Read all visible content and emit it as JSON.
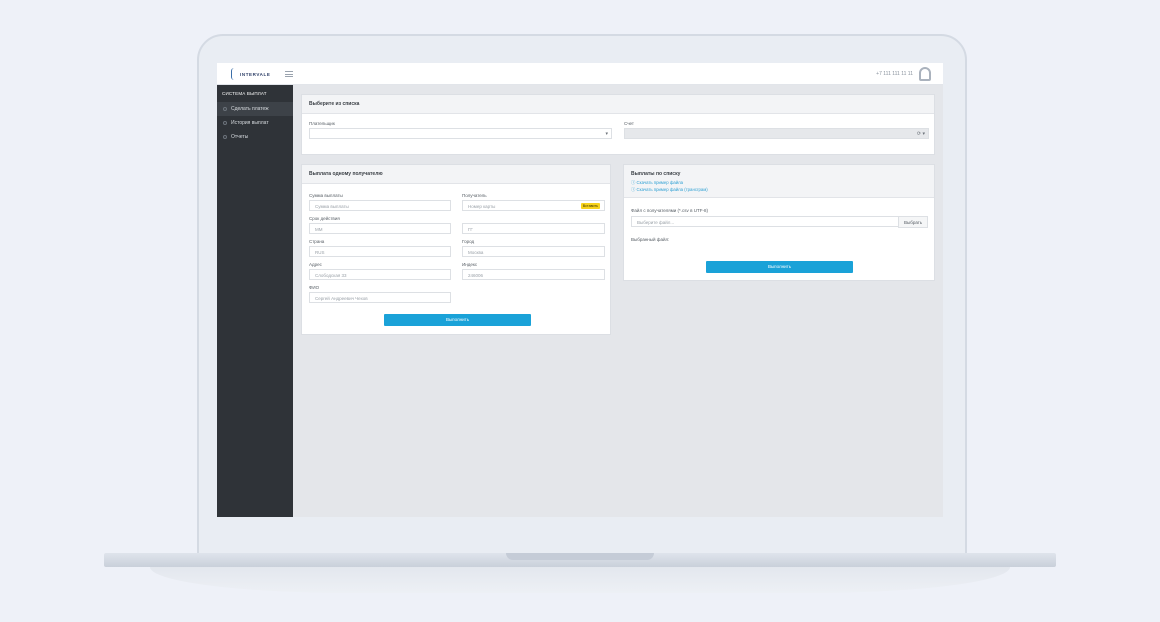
{
  "app": {
    "logo_text": "INTERVALE",
    "phone": "+7 111 111 11 11"
  },
  "sidebar": {
    "title": "СИСТЕМА ВЫПЛАТ",
    "items": [
      {
        "label": "Сделать платеж",
        "active": true
      },
      {
        "label": "История выплат",
        "active": false
      },
      {
        "label": "Отчеты",
        "active": false
      }
    ]
  },
  "select_panel": {
    "title": "Выберите из списка",
    "payer_label": "Плательщик",
    "payer_value": "",
    "account_label": "Счет",
    "account_value": ""
  },
  "single_payout": {
    "title": "Выплата одному получателю",
    "amount_label": "Сумма выплаты",
    "amount_placeholder": "Сумма выплаты",
    "recipient_label": "Получатель",
    "recipient_placeholder": "Номер карты",
    "recipient_badge": "Вставить",
    "validity_label": "Срок действия",
    "month_placeholder": "ММ",
    "year_placeholder": "ГГ",
    "country_label": "Страна",
    "country_placeholder": "RUS",
    "city_label": "Город",
    "city_placeholder": "Москва",
    "address_label": "Адрес",
    "address_placeholder": "Слободская 33",
    "zip_label": "Индекс",
    "zip_placeholder": "246006",
    "fio_label": "ФИО",
    "fio_placeholder": "Сергей Андреевич Чехов",
    "submit_label": "Выполнить"
  },
  "list_payout": {
    "title": "Выплаты по списку",
    "link1": "Скачать пример файла",
    "link2": "Скачать пример файла (трансграм)",
    "file_label": "Файл с получателями (*.csv в UTF-8)",
    "file_placeholder": "Выберите файл...",
    "pick_label": "Выбрать",
    "selected_label": "Выбранный файл:",
    "submit_label": "Выполнить"
  },
  "colors": {
    "accent": "#1aa2d8",
    "sidebar": "#2f3338",
    "badge": "#f7d21b"
  }
}
